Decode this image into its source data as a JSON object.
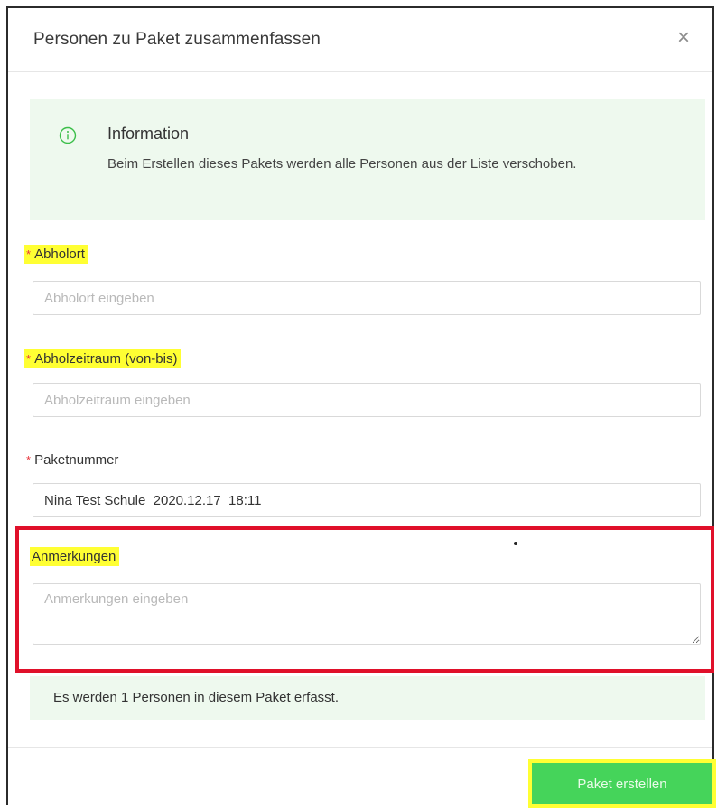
{
  "modal": {
    "title": "Personen zu Paket zusammenfassen",
    "close_icon": "close-icon"
  },
  "info": {
    "icon": "info-circle-icon",
    "title": "Information",
    "text": "Beim Erstellen dieses Pakets werden alle Personen aus der Liste verschoben."
  },
  "form": {
    "required_marker": "*",
    "pickup_location": {
      "label": "Abholort",
      "placeholder": "Abholort eingeben",
      "value": ""
    },
    "pickup_period": {
      "label": "Abholzeitraum (von-bis)",
      "placeholder": "Abholzeitraum eingeben",
      "value": ""
    },
    "package_number": {
      "label": "Paketnummer",
      "placeholder": "",
      "value": "Nina Test Schule_2020.12.17_18:11"
    },
    "remarks": {
      "label": "Anmerkungen",
      "placeholder": "Anmerkungen eingeben",
      "value": ""
    }
  },
  "summary": {
    "text": "Es werden 1 Personen in diesem Paket erfasst."
  },
  "footer": {
    "create_button_label": "Paket erstellen"
  },
  "colors": {
    "info_background": "#eef9ee",
    "info_icon": "#3cbf4a",
    "required_star": "#e8363c",
    "highlight": "#ffff33",
    "annotation_frame": "#e0102a",
    "primary_button": "#45d45a"
  }
}
